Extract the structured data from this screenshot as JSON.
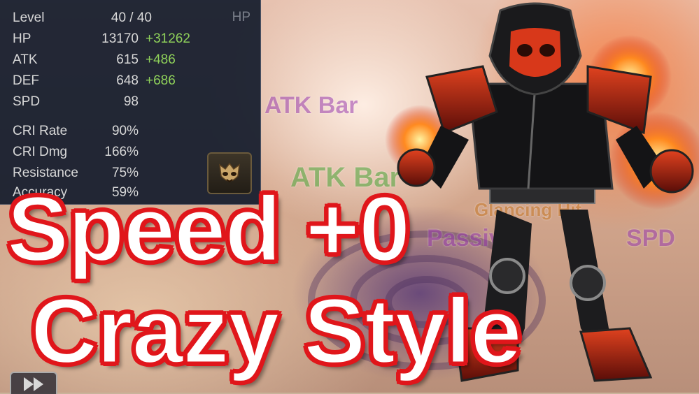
{
  "stats_panel": {
    "corner_tag": "HP",
    "rows": [
      {
        "label": "Level",
        "value": "40 / 40",
        "bonus": ""
      },
      {
        "label": "HP",
        "value": "13170",
        "bonus": "+31262"
      },
      {
        "label": "ATK",
        "value": "615",
        "bonus": "+486"
      },
      {
        "label": "DEF",
        "value": "648",
        "bonus": "+686"
      },
      {
        "label": "SPD",
        "value": "98",
        "bonus": ""
      },
      {
        "label": "CRI Rate",
        "value": "90%",
        "bonus": ""
      },
      {
        "label": "CRI Dmg",
        "value": "166%",
        "bonus": ""
      },
      {
        "label": "Resistance",
        "value": "75%",
        "bonus": ""
      },
      {
        "label": "Accuracy",
        "value": "59%",
        "bonus": ""
      }
    ],
    "skill_icon": "mask-icon"
  },
  "headline": {
    "line1": "Speed +0",
    "line2": "Crazy Style"
  },
  "battle_effects": [
    "ATK Bar",
    "ATK Bar",
    "Passive",
    "SPD",
    "Glancing Hit"
  ],
  "colors": {
    "headline_fill": "#ffffff",
    "headline_outline": "#e0161b",
    "panel_bg": "#161e2e",
    "bonus_green": "#8fd15a"
  },
  "controls": {
    "fast_forward_icon": "fast-forward-icon"
  }
}
